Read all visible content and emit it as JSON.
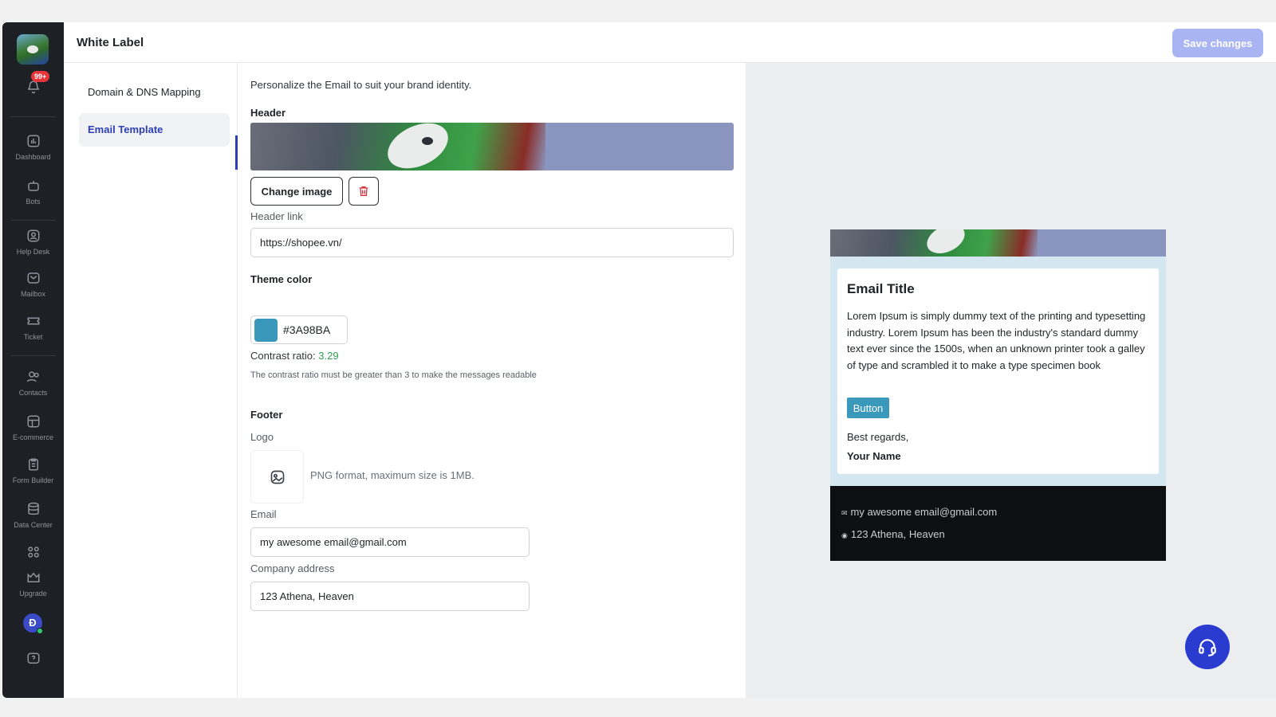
{
  "sidebar": {
    "notification_badge": "99+",
    "items": [
      {
        "label": "Dashboard",
        "icon": "dashboard-icon"
      },
      {
        "label": "Bots",
        "icon": "bot-icon"
      },
      {
        "label": "Help Desk",
        "icon": "help-desk-icon"
      },
      {
        "label": "Mailbox",
        "icon": "mailbox-icon"
      },
      {
        "label": "Ticket",
        "icon": "ticket-icon"
      },
      {
        "label": "Contacts",
        "icon": "contacts-icon"
      },
      {
        "label": "E-commerce",
        "icon": "ecommerce-icon"
      },
      {
        "label": "Form Builder",
        "icon": "form-builder-icon"
      },
      {
        "label": "Data Center",
        "icon": "data-center-icon"
      },
      {
        "label": "",
        "icon": "apps-grid-icon"
      },
      {
        "label": "Upgrade",
        "icon": "upgrade-icon"
      }
    ],
    "avatar_initial": "Đ"
  },
  "header": {
    "title": "White Label",
    "save_label": "Save changes"
  },
  "subnav": {
    "items": [
      {
        "label": "Domain & DNS Mapping",
        "active": false
      },
      {
        "label": "Email Template",
        "active": true
      }
    ]
  },
  "form": {
    "intro": "Personalize the Email to suit your brand identity.",
    "header_title": "Header",
    "change_image_label": "Change image",
    "header_link_label": "Header link",
    "header_link_value": "https://shopee.vn/",
    "theme_color_title": "Theme color",
    "theme_color_hex": "#3A98BA",
    "contrast_label": "Contrast ratio:",
    "contrast_value": "3.29",
    "contrast_note": "The contrast ratio must be greater than 3 to make the messages readable",
    "footer_title": "Footer",
    "logo_label": "Logo",
    "logo_hint": "PNG format, maximum size is 1MB.",
    "email_label": "Email",
    "email_value": "my awesome email@gmail.com",
    "address_label": "Company address",
    "address_value": "123 Athena, Heaven"
  },
  "preview": {
    "email_title": "Email Title",
    "body_text": "Lorem Ipsum is simply dummy text of the printing and typesetting industry. Lorem Ipsum has been the industry's standard dummy text ever since the 1500s, when an unknown printer took a galley of type and scrambled it to make a type specimen book",
    "button_label": "Button",
    "regards": "Best regards,",
    "your_name": "Your Name",
    "footer_email": "my awesome email@gmail.com",
    "footer_address": "123 Athena, Heaven"
  },
  "colors": {
    "theme": "#3A98BA",
    "accent": "#2c3fb8",
    "save_button": "#a9b4f3",
    "sidebar_bg": "#1d2024"
  }
}
